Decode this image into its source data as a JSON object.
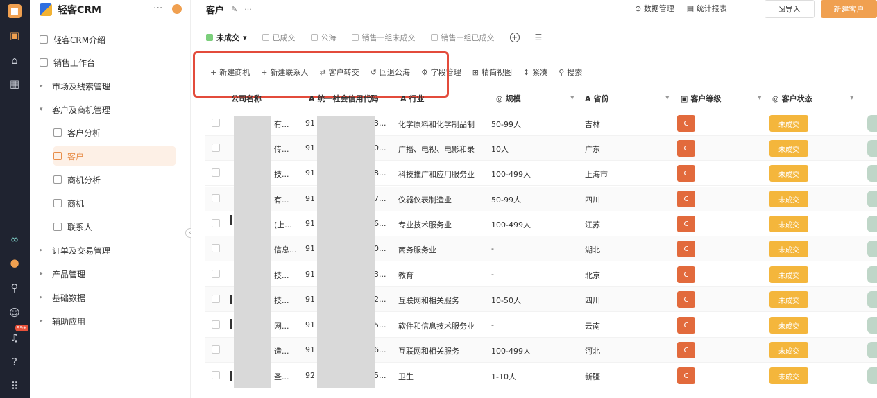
{
  "rail": {
    "icons": [
      "app-logo",
      "home",
      "grid",
      "wave",
      "orange-dot",
      "search",
      "users",
      "bell",
      "help",
      "apps"
    ],
    "badge": "99+"
  },
  "sidebar": {
    "brand": "轻客CRM",
    "items": [
      {
        "label": "轻客CRM介绍",
        "type": "page"
      },
      {
        "label": "销售工作台",
        "type": "page"
      },
      {
        "label": "市场及线索管理",
        "type": "group",
        "expanded": false
      },
      {
        "label": "客户及商机管理",
        "type": "group",
        "expanded": true
      },
      {
        "label": "客户分析",
        "type": "sub"
      },
      {
        "label": "客户",
        "type": "sub",
        "active": true
      },
      {
        "label": "商机分析",
        "type": "sub"
      },
      {
        "label": "商机",
        "type": "sub"
      },
      {
        "label": "联系人",
        "type": "sub"
      },
      {
        "label": "订单及交易管理",
        "type": "group",
        "expanded": false
      },
      {
        "label": "产品管理",
        "type": "group",
        "expanded": false
      },
      {
        "label": "基础数据",
        "type": "group",
        "expanded": false
      },
      {
        "label": "辅助应用",
        "type": "group",
        "expanded": false
      }
    ]
  },
  "header": {
    "title": "客户",
    "actions": [
      "数据管理",
      "统计报表"
    ],
    "import_label": "导入",
    "new_label": "新建客户"
  },
  "tabs": [
    "未成交",
    "已成交",
    "公海",
    "销售一组未成交",
    "销售一组已成交"
  ],
  "toolbar": [
    "新建商机",
    "新建联系人",
    "客户转交",
    "回退公海",
    "字段管理",
    "精简视图",
    "紧凑",
    "搜索"
  ],
  "columns": {
    "name": "公司名称",
    "credit": "统一社会信用代码",
    "industry": "行业",
    "scale": "规模",
    "province": "省份",
    "level": "客户等级",
    "status": "客户状态"
  },
  "rows": [
    {
      "name": "有...",
      "credit_prefix": "91",
      "credit_suffix": "3...",
      "industry": "化学原料和化学制品制",
      "scale": "50-99人",
      "province": "吉林",
      "level": "C",
      "status": "未成交"
    },
    {
      "name": "传...",
      "credit_prefix": "91",
      "credit_suffix": "0...",
      "industry": "广播、电视、电影和录",
      "scale": "10人",
      "province": "广东",
      "level": "C",
      "status": "未成交"
    },
    {
      "name": "技...",
      "credit_prefix": "91",
      "credit_suffix": "8...",
      "industry": "科技推广和应用服务业",
      "scale": "100-499人",
      "province": "上海市",
      "level": "C",
      "status": "未成交"
    },
    {
      "name": "有...",
      "credit_prefix": "91",
      "credit_suffix": "7...",
      "industry": "仪器仪表制造业",
      "scale": "50-99人",
      "province": "四川",
      "level": "C",
      "status": "未成交"
    },
    {
      "name": "(上...",
      "credit_prefix": "91",
      "credit_suffix": "6...",
      "industry": "专业技术服务业",
      "scale": "100-499人",
      "province": "江苏",
      "level": "C",
      "status": "未成交"
    },
    {
      "name": "信息...",
      "credit_prefix": "91",
      "credit_suffix": "0...",
      "industry": "商务服务业",
      "scale": "-",
      "province": "湖北",
      "level": "C",
      "status": "未成交"
    },
    {
      "name": "技...",
      "credit_prefix": "91",
      "credit_suffix": "3...",
      "industry": "教育",
      "scale": "-",
      "province": "北京",
      "level": "C",
      "status": "未成交"
    },
    {
      "name": "技...",
      "credit_prefix": "91",
      "credit_suffix": "2...",
      "industry": "互联网和相关服务",
      "scale": "10-50人",
      "province": "四川",
      "level": "C",
      "status": "未成交"
    },
    {
      "name": "网...",
      "credit_prefix": "91",
      "credit_suffix": "5...",
      "industry": "软件和信息技术服务业",
      "scale": "-",
      "province": "云南",
      "level": "C",
      "status": "未成交"
    },
    {
      "name": "造...",
      "credit_prefix": "91",
      "credit_suffix": "6...",
      "industry": "互联网和相关服务",
      "scale": "100-499人",
      "province": "河北",
      "level": "C",
      "status": "未成交"
    },
    {
      "name": "圣...",
      "credit_prefix": "92",
      "credit_suffix": "5...",
      "industry": "卫生",
      "scale": "1-10人",
      "province": "新疆",
      "level": "C",
      "status": "未成交"
    }
  ],
  "colors": {
    "accent": "#f0a050",
    "level": "#e26a3c",
    "status": "#f4b63c",
    "highlight": "#e34b3b"
  }
}
